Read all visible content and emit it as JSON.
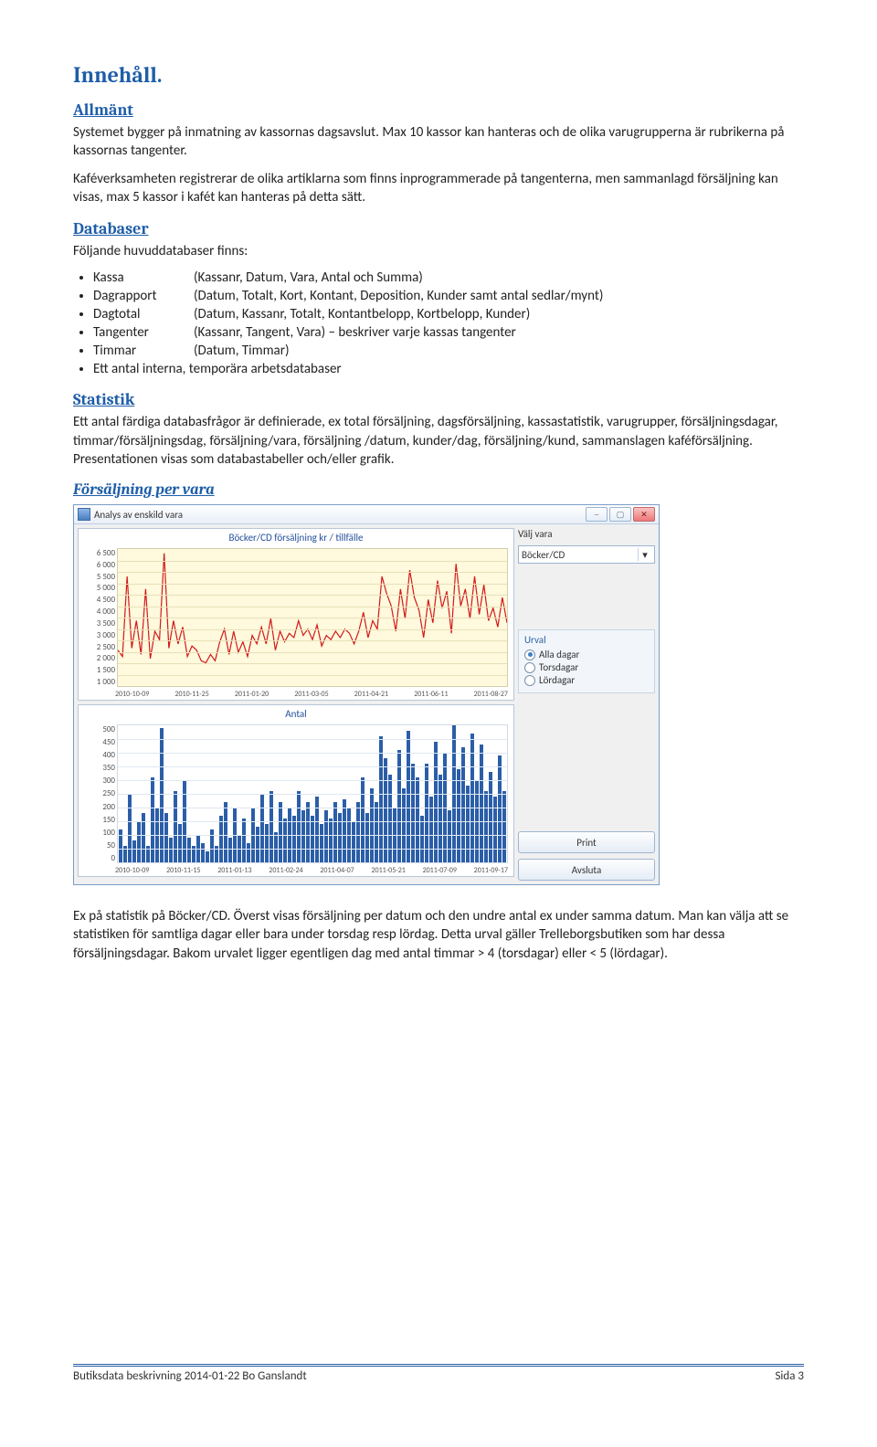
{
  "headings": {
    "h1": "Innehåll.",
    "allmant": "Allmänt",
    "databaser": "Databaser",
    "statistik": "Statistik",
    "forsaljning": "Försäljning per vara"
  },
  "paragraphs": {
    "p1": "Systemet bygger på inmatning av kassornas dagsavslut. Max 10 kassor kan hanteras och de olika varugrupperna är rubrikerna på kassornas tangenter.",
    "p2": "Kaféverksamheten registrerar de olika artiklarna som finns inprogrammerade på tangenterna, men sammanlagd försäljning kan visas, max 5 kassor i kafét kan hanteras på detta sätt.",
    "p3": "Följande huvuddatabaser finns:",
    "p4": "Ett antal färdiga databasfrågor är definierade, ex total försäljning, dagsförsäljning, kassastatistik, varugrupper, försäljningsdagar, timmar/försäljningsdag, försäljning/vara, försäljning /datum, kunder/dag, försäljning/kund, sammanslagen kaféförsäljning. Presentationen visas som databastabeller och/eller grafik.",
    "p5": "Ex på statistik på Böcker/CD. Överst visas försäljning per datum och den undre antal ex under samma datum. Man kan välja att se statistiken för samtliga dagar eller bara under torsdag resp lördag. Detta urval gäller Trelleborgsbutiken som har dessa försäljningsdagar. Bakom urvalet ligger egentligen dag med antal timmar > 4 (torsdagar) eller < 5 (lördagar)."
  },
  "dblist": [
    {
      "k": "Kassa",
      "v": "(Kassanr, Datum, Vara, Antal och Summa)"
    },
    {
      "k": "Dagrapport",
      "v": "(Datum, Totalt, Kort, Kontant, Deposition, Kunder samt antal sedlar/mynt)"
    },
    {
      "k": "Dagtotal",
      "v": "(Datum, Kassanr, Totalt, Kontantbelopp, Kortbelopp, Kunder)"
    },
    {
      "k": "Tangenter",
      "v": "(Kassanr, Tangent, Vara) – beskriver varje kassas tangenter"
    },
    {
      "k": "Timmar",
      "v": "(Datum, Timmar)"
    }
  ],
  "dblist_last": "Ett antal interna, temporära arbetsdatabaser",
  "window": {
    "title": "Analys av enskild vara",
    "valj_vara_label": "Välj vara",
    "valj_vara_value": "Böcker/CD",
    "urval_label": "Urval",
    "urval_options": [
      "Alla dagar",
      "Torsdagar",
      "Lördagar"
    ],
    "urval_selected": 0,
    "print": "Print",
    "avsluta": "Avsluta"
  },
  "chart_data": [
    {
      "type": "line",
      "title": "Böcker/CD  försäljning  kr / tillfälle",
      "ylabel": "",
      "ylim": [
        0,
        6500
      ],
      "yticks": [
        "6 500",
        "6 000",
        "5 500",
        "5 000",
        "4 500",
        "4 000",
        "3 500",
        "3 000",
        "2 500",
        "2 000",
        "1 500",
        "1 000"
      ],
      "x_categories": [
        "2010-10-09",
        "2010-11-25",
        "2011-01-20",
        "2011-03-05",
        "2011-04-21",
        "2011-06-11",
        "2011-08-27"
      ],
      "values": [
        1700,
        1400,
        5200,
        1800,
        3100,
        1500,
        4600,
        1300,
        2600,
        2200,
        6300,
        1800,
        3100,
        2000,
        2800,
        1400,
        1900,
        1700,
        1200,
        1100,
        1500,
        1200,
        2100,
        2700,
        1500,
        2600,
        1600,
        2100,
        1400,
        2400,
        2000,
        2800,
        2000,
        3200,
        1700,
        2600,
        2100,
        2500,
        2300,
        3100,
        2400,
        2700,
        2200,
        2900,
        1900,
        2400,
        2200,
        2600,
        2300,
        2700,
        2500,
        2000,
        2600,
        3500,
        2300,
        3100,
        2700,
        5200,
        4400,
        3800,
        2600,
        4600,
        3200,
        5500,
        4200,
        3600,
        2300,
        4100,
        3000,
        5000,
        3700,
        4500,
        2500,
        5800,
        3800,
        4600,
        3200,
        5200,
        3400,
        4800,
        3100,
        3700,
        2800,
        4200,
        3000
      ],
      "color": "#d21a1a"
    },
    {
      "type": "bar",
      "title": "Antal",
      "ylabel": "",
      "ylim": [
        0,
        500
      ],
      "yticks": [
        "500",
        "450",
        "400",
        "350",
        "300",
        "250",
        "200",
        "150",
        "100",
        "50",
        "0"
      ],
      "x_categories": [
        "2010-10-09",
        "2010-11-15",
        "2011-01-13",
        "2011-02-24",
        "2011-04-07",
        "2011-05-21",
        "2011-07-09",
        "2011-09-17"
      ],
      "values": [
        120,
        60,
        250,
        80,
        150,
        180,
        60,
        310,
        200,
        490,
        180,
        90,
        260,
        140,
        300,
        90,
        60,
        100,
        70,
        40,
        120,
        60,
        170,
        220,
        90,
        200,
        100,
        160,
        70,
        200,
        130,
        250,
        140,
        260,
        110,
        220,
        160,
        200,
        170,
        260,
        190,
        220,
        170,
        240,
        140,
        190,
        160,
        220,
        180,
        230,
        200,
        150,
        220,
        310,
        180,
        270,
        220,
        460,
        380,
        320,
        200,
        410,
        270,
        480,
        360,
        310,
        170,
        360,
        240,
        440,
        320,
        400,
        190,
        500,
        340,
        420,
        280,
        470,
        300,
        430,
        260,
        330,
        240,
        390,
        260
      ],
      "color": "#2b5ea8"
    }
  ],
  "footer": {
    "left": "Butiksdata beskrivning 2014-01-22 Bo Ganslandt",
    "right": "Sida 3"
  }
}
